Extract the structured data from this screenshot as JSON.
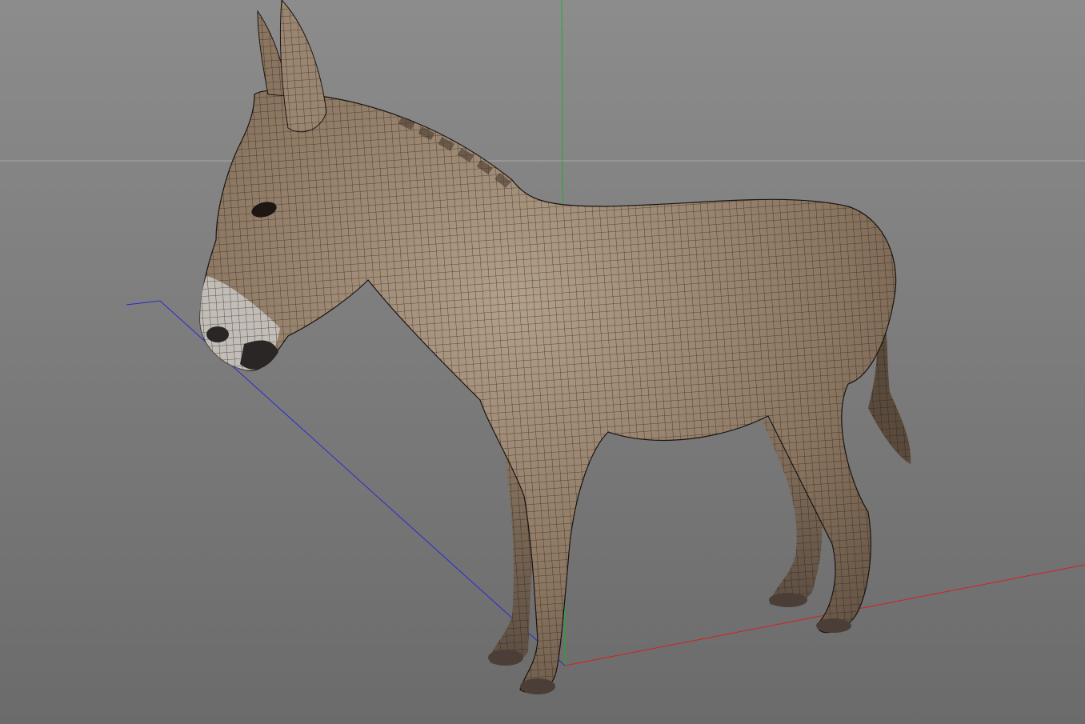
{
  "viewport": {
    "background_top": "#8c8c8c",
    "background_bottom": "#6b6b6b",
    "horizon_color": "#a8a8a8",
    "axis_x_color": "#d42020",
    "axis_y_color": "#1fae2f",
    "axis_z_color": "#2a2ad0"
  },
  "model": {
    "fur_color": "#8a7560",
    "fur_light": "#b3a08a",
    "wire_color": "#1a1410",
    "muzzle_color": "#c8c4c0",
    "nose_color": "#2a2626"
  }
}
